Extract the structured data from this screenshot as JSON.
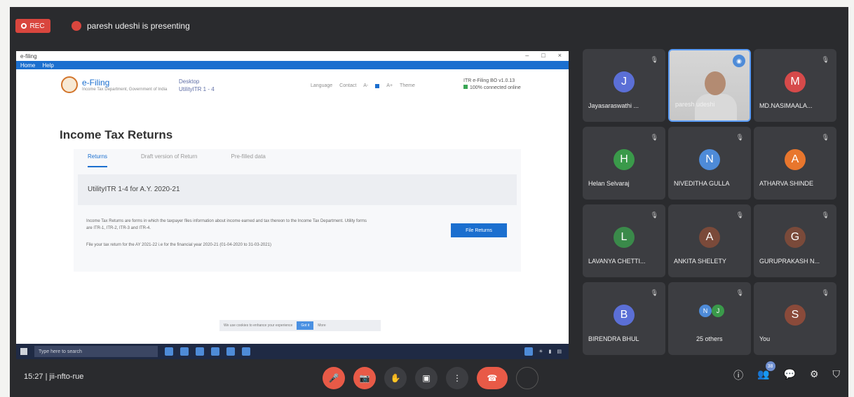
{
  "recording": {
    "label": "REC"
  },
  "presenter": {
    "text": "paresh udeshi is presenting"
  },
  "shared": {
    "window_title": "e-filing",
    "menu": [
      "Home",
      "Help"
    ],
    "logo_title": "e-Filing",
    "logo_sub": "Income Tax Department, Government of India",
    "desktop_label": "Desktop",
    "utility_label": "UtilityITR 1 - 4",
    "tools": [
      "Language",
      "Contact",
      "A-",
      "A",
      "A+",
      "Theme"
    ],
    "version": "ITR e-Filing BO v1.0.13",
    "version_sub": "100% connected online",
    "page_title": "Income Tax Returns",
    "tabs": [
      "Returns",
      "Draft version of Return",
      "Pre-filled data"
    ],
    "utility_heading": "UtilityITR 1-4 for A.Y. 2020-21",
    "info_line1": "Income Tax Returns are forms in which the taxpayer files information about income earned and tax thereon to the Income Tax Department. Utility forms are ITR-1, ITR-2, ITR-3 and ITR-4.",
    "info_line2": "File your tax return for the AY 2021-22 i.e for the financial year 2020-21 (01-04-2020 to 31-03-2021)",
    "file_button": "File Returns",
    "cookie_text": "We use cookies to enhance your experience",
    "cookie_ok": "Got it",
    "cookie_more": "More",
    "taskbar_search": "Type here to search"
  },
  "participants": [
    {
      "name": "Jayasaraswathi ...",
      "initial": "J",
      "color": "#5b6fd6"
    },
    {
      "name": "paresh udeshi",
      "initial": "",
      "color": "",
      "camera": true
    },
    {
      "name": "MD.NASIMAALA...",
      "initial": "M",
      "color": "#d64a4a"
    },
    {
      "name": "Helan Selvaraj",
      "initial": "H",
      "color": "#3a9a4a"
    },
    {
      "name": "NIVEDITHA GULLA",
      "initial": "N",
      "color": "#4e8bd8"
    },
    {
      "name": "ATHARVA SHINDE",
      "initial": "A",
      "color": "#e8762d"
    },
    {
      "name": "LAVANYA CHETTI...",
      "initial": "L",
      "color": "#3a8a4a"
    },
    {
      "name": "ANKITA SHELETY",
      "initial": "A",
      "color": "#7a4a3a"
    },
    {
      "name": "GURUPRAKASH N...",
      "initial": "G",
      "color": "#7a4a3a"
    },
    {
      "name": "BIRENDRA BHUL",
      "initial": "B",
      "color": "#5b6fd6"
    },
    {
      "name": "25 others",
      "initial": "",
      "color": ""
    },
    {
      "name": "You",
      "initial": "S",
      "color": "#8a4a3a"
    }
  ],
  "bottom": {
    "time": "15:27",
    "meeting_code": "jii-nfto-rue",
    "participant_count": "38"
  }
}
